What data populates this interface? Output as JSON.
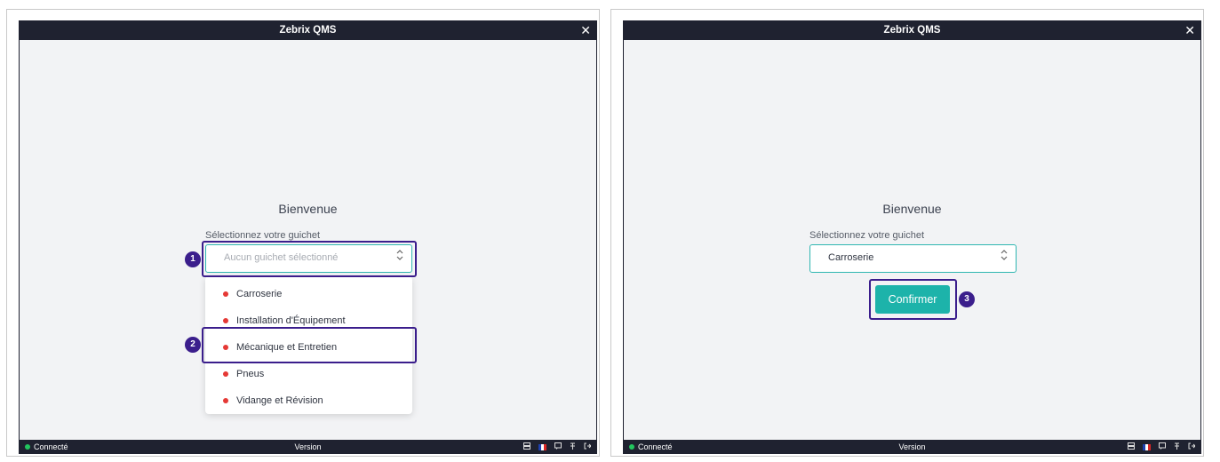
{
  "left": {
    "title": "Zebrix QMS",
    "close": "✕",
    "welcome": "Bienvenue",
    "select_label": "Sélectionnez votre guichet",
    "placeholder": "Aucun guichet sélectionné",
    "options": [
      "Carroserie",
      "Installation d'Équipement",
      "Mécanique et Entretien",
      "Pneus",
      "Vidange et Révision"
    ],
    "badges": [
      "1",
      "2"
    ],
    "status": {
      "connected": "Connecté",
      "version": "Version"
    }
  },
  "right": {
    "title": "Zebrix QMS",
    "close": "✕",
    "welcome": "Bienvenue",
    "select_label": "Sélectionnez votre guichet",
    "selected": "Carroserie",
    "confirm": "Confirmer",
    "badges": [
      "3"
    ],
    "status": {
      "connected": "Connecté",
      "version": "Version"
    }
  },
  "colors": {
    "accent": "#1db3aa",
    "highlight": "#3b1e8c",
    "titlebar": "#1f2230",
    "option_dot": "#e53935",
    "connected_dot": "#22c55e"
  },
  "icons": {
    "status_bar": [
      "server-icon",
      "flag-fr-icon",
      "chat-icon",
      "pin-icon",
      "logout-icon"
    ],
    "select": "chevron-updown-icon"
  }
}
